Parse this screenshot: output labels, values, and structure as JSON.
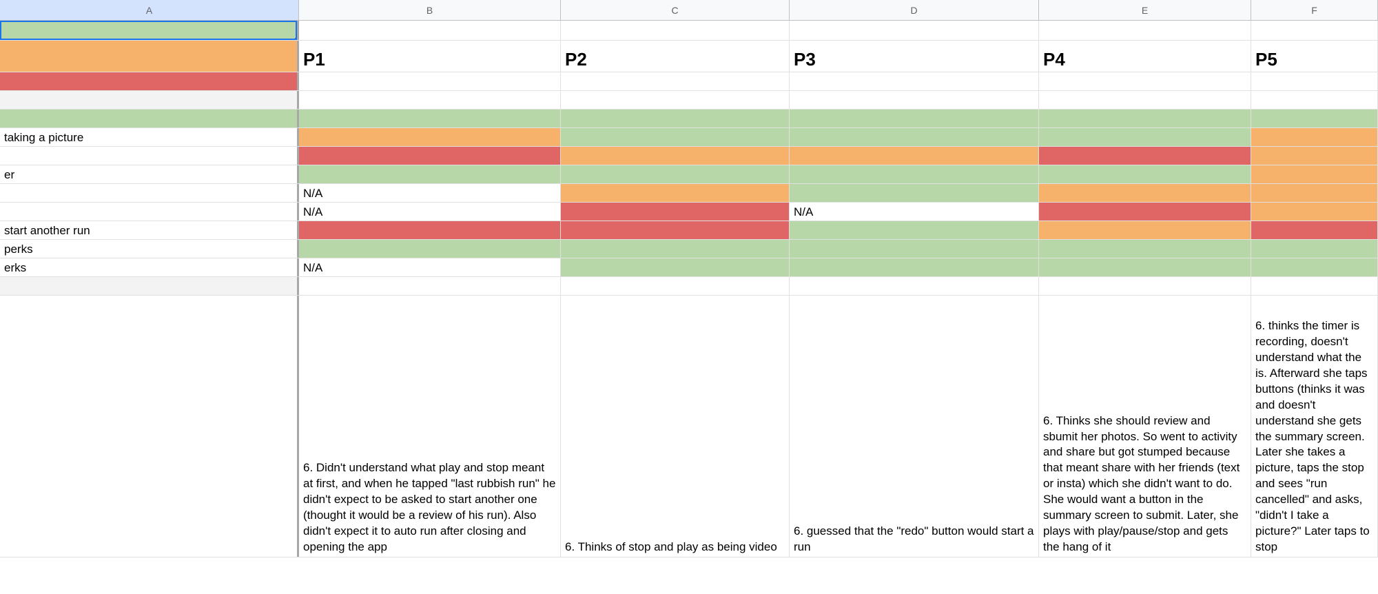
{
  "columns": {
    "A": "A",
    "B": "B",
    "C": "C",
    "D": "D",
    "E": "E",
    "F": "F"
  },
  "participants": {
    "P1": "P1",
    "P2": "P2",
    "P3": "P3",
    "P4": "P4",
    "P5": "P5"
  },
  "sideLabels": {
    "taking_picture": "taking a picture",
    "er": "er",
    "start_another": "start another run",
    "perks": "perks",
    "erks": "erks"
  },
  "na": "N/A",
  "notes": {
    "p1": "6. Didn't understand what play and stop meant at first, and when he tapped \"last rubbish run\" he didn't expect to be asked to start another one (thought it would be a review of his run). Also didn't expect it to auto run after closing and opening the app",
    "p2": "6. Thinks of stop and play as being video",
    "p3": "6. guessed that the \"redo\" button would start a run",
    "p4": "6. Thinks she should review and sbumit her photos. So went to activity and share but got stumped because that meant share with her friends (text or insta) which she didn't want to do. She would want a button in the summary screen to submit. Later, she plays with play/pause/stop and gets the hang of it",
    "p5": "6. thinks the timer is recording, doesn't understand what the is. Afterward she taps buttons (thinks it was and doesn't understand she gets the summary screen. Later she takes a picture, taps the stop and sees \"run cancelled\" and asks, \"didn't I take a picture?\" Later taps to stop"
  }
}
